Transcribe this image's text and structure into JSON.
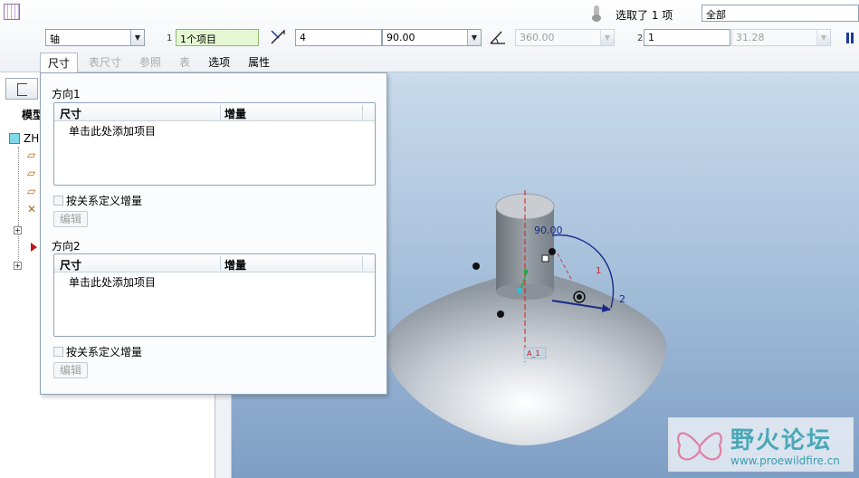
{
  "dashboard": {
    "selection_status": "选取了 1 项",
    "filter_value": "全部",
    "ref_type": "轴",
    "dir1_index": "1",
    "dir1_collector": "1个项目",
    "count1": "4",
    "angle1": "90.00",
    "range_value": "360.00",
    "dir2_index": "2",
    "count2": "1",
    "increment2": "31.28"
  },
  "tabs": [
    {
      "label": "尺寸",
      "state": "active"
    },
    {
      "label": "表尺寸",
      "state": "disabled"
    },
    {
      "label": "参照",
      "state": "disabled"
    },
    {
      "label": "表",
      "state": "disabled"
    },
    {
      "label": "选项",
      "state": "enabled"
    },
    {
      "label": "属性",
      "state": "enabled"
    }
  ],
  "model_tree": {
    "title": "模型",
    "root": "ZH"
  },
  "panel": {
    "direction1": {
      "label": "方向1",
      "col_dimension": "尺寸",
      "col_increment": "增量",
      "add_prompt": "单击此处添加项目",
      "relation_checkbox": "按关系定义增量",
      "edit_button": "编辑"
    },
    "direction2": {
      "label": "方向2",
      "col_dimension": "尺寸",
      "col_increment": "增量",
      "add_prompt": "单击此处添加项目",
      "relation_checkbox": "按关系定义增量",
      "edit_button": "编辑"
    }
  },
  "viewport": {
    "angle_dim": "90.00",
    "direction_label": "2",
    "small_tag": "A_1",
    "marker": "1"
  },
  "watermark": {
    "title": "野火论坛",
    "url": "www.proewildfire.cn"
  },
  "colors": {
    "accent_green_field": "#e6f8d2",
    "dimension_blue": "#1a2a8a",
    "axis_red": "#d02020"
  }
}
